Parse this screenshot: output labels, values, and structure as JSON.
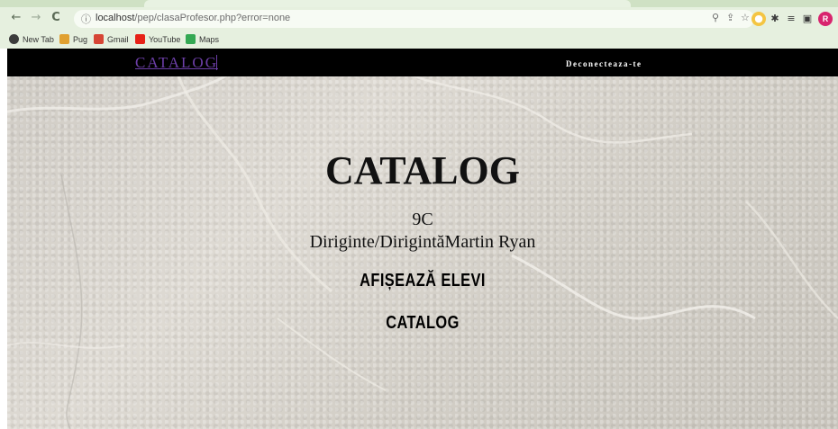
{
  "browser": {
    "nav": {
      "back": "←",
      "forward": "→",
      "reload": "C"
    },
    "url_host": "localhost",
    "url_path": "/pep/clasaProfesor.php?error=none",
    "bookmarks": [
      {
        "label": "New Tab",
        "icon": "globe-icon",
        "color": "#3c3c3c"
      },
      {
        "label": "Pug",
        "icon": "pug-icon",
        "color": "#e0a030"
      },
      {
        "label": "Gmail",
        "icon": "gmail-icon",
        "color": "#d64535"
      },
      {
        "label": "YouTube",
        "icon": "youtube-icon",
        "color": "#e62117"
      },
      {
        "label": "Maps",
        "icon": "maps-icon",
        "color": "#34a853"
      }
    ],
    "avatar_letter": "R"
  },
  "site": {
    "brand": "CATALOG",
    "logout": "Deconecteaza-te"
  },
  "main": {
    "title": "CATALOG",
    "class_name": "9C",
    "teacher": "Diriginte/DirigintăMartin Ryan",
    "actions": [
      "AFIȘEAZĂ ELEVI",
      "CATALOG"
    ]
  }
}
